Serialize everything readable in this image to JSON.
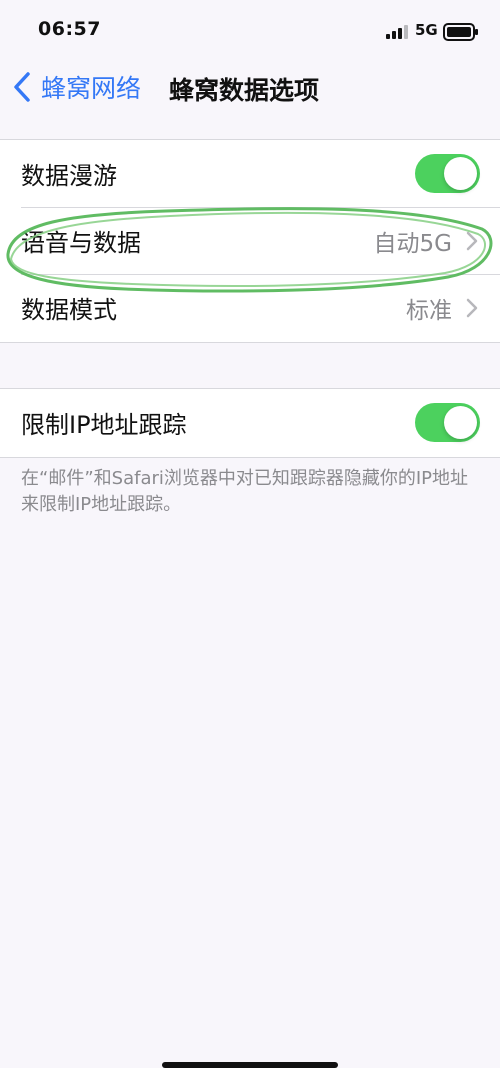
{
  "status_bar": {
    "time": "06:57",
    "network": "5G"
  },
  "nav": {
    "back_label": "蜂窝网络",
    "title": "蜂窝数据选项"
  },
  "settings": [
    {
      "label": "数据漫游",
      "type": "toggle",
      "enabled": true
    },
    {
      "label": "语音与数据",
      "type": "detail",
      "value": "自动5G"
    },
    {
      "label": "数据模式",
      "type": "detail",
      "value": "标准"
    }
  ],
  "privacy": {
    "label": "限制IP地址跟踪",
    "enabled": true,
    "footer": "在“邮件”和Safari浏览器中对已知跟踪器隐藏你的IP地址来限制IP地址跟踪。"
  },
  "colors": {
    "accent": "#3478f6",
    "toggle_on": "#4cd15e",
    "background": "#f8f6fb",
    "highlight_marker": "#57b85b"
  }
}
